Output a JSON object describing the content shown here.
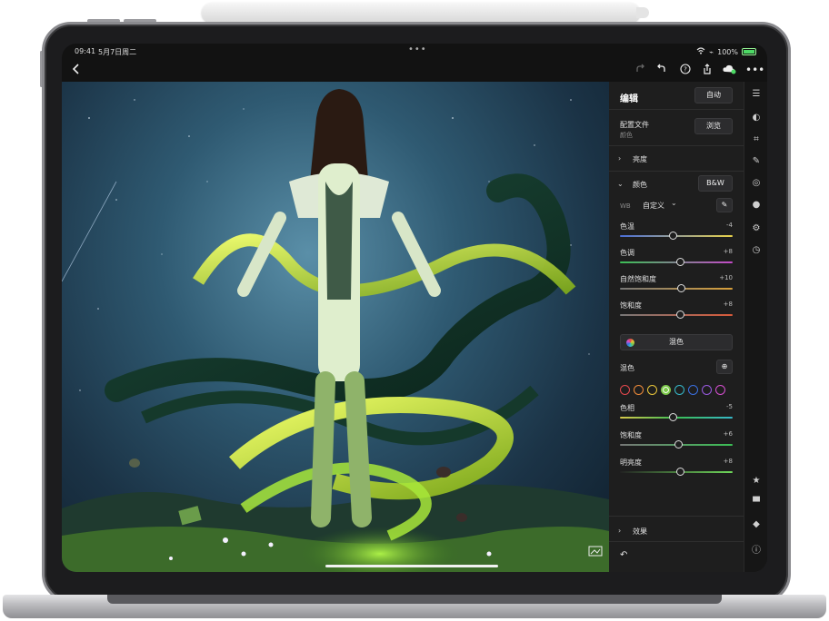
{
  "status": {
    "time": "09:41",
    "date": "5月7日周二",
    "battery": "100%"
  },
  "colors": {
    "accent": "#f4f4f4",
    "panel": "#1e1e1e",
    "rail": "#161616",
    "photo_sky": "#2f5a72"
  },
  "toolbar": {
    "back_icon": "chevron-left-icon",
    "icons": [
      "redo-icon",
      "undo-icon",
      "help-icon",
      "share-icon",
      "cloud-sync-icon",
      "more-icon"
    ]
  },
  "edit": {
    "title": "编辑",
    "auto_label": "自动",
    "profile": {
      "label": "配置文件",
      "value": "颜色",
      "browse_label": "浏览"
    },
    "light": {
      "label": "亮度"
    },
    "color": {
      "label": "颜色",
      "bw_label": "B&W",
      "wb_label": "WB",
      "wb_value": "自定义",
      "sliders": [
        {
          "label": "色温",
          "value": "-4",
          "fraction": 0.47
        },
        {
          "label": "色调",
          "value": "+8",
          "fraction": 0.53
        },
        {
          "label": "自然饱和度",
          "value": "+10",
          "fraction": 0.54
        },
        {
          "label": "饱和度",
          "value": "+8",
          "fraction": 0.53
        }
      ],
      "mix_button": "混色",
      "mix_label": "混色",
      "swatches": [
        "#e5484d",
        "#f08c3a",
        "#e8c53a",
        "#7cc84a",
        "#36b8c9",
        "#3a6fe0",
        "#9a5ae0",
        "#d64fd0"
      ],
      "selected_swatch": 3,
      "mix_sliders": [
        {
          "label": "色相",
          "value": "-5",
          "fraction": 0.47
        },
        {
          "label": "饱和度",
          "value": "+6",
          "fraction": 0.52
        },
        {
          "label": "明亮度",
          "value": "+8",
          "fraction": 0.53
        }
      ]
    },
    "effects": {
      "label": "效果"
    }
  },
  "rail_icons": [
    "sliders-icon",
    "mask-icon",
    "crop-icon",
    "healing-icon",
    "filter-icon",
    "droplet-icon",
    "presets-icon",
    "history-icon",
    "star-icon",
    "comment-icon",
    "tag-icon",
    "info-icon"
  ],
  "bottom": {
    "reset_icon": "undo-arrow-icon"
  }
}
